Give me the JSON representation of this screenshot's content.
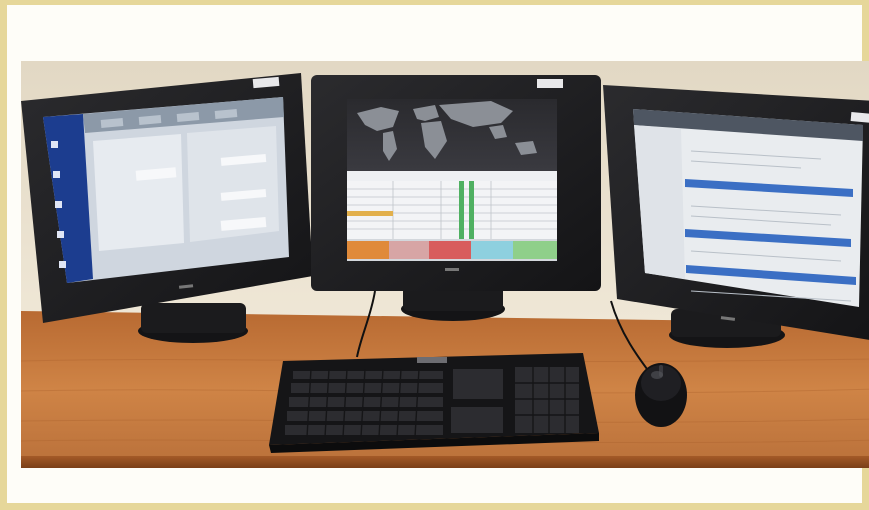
{
  "photo": {
    "subject": "",
    "monitors": [
      {
        "position": "left",
        "screen": "desktop-application"
      },
      {
        "position": "center",
        "screen": "world-map-dashboard"
      },
      {
        "position": "right",
        "screen": "web-portal"
      }
    ],
    "colors": {
      "border": "#e6d79a",
      "wall": "#e9dfcc",
      "desk": "#c8783a",
      "bezel": "#1d1d1f"
    }
  }
}
